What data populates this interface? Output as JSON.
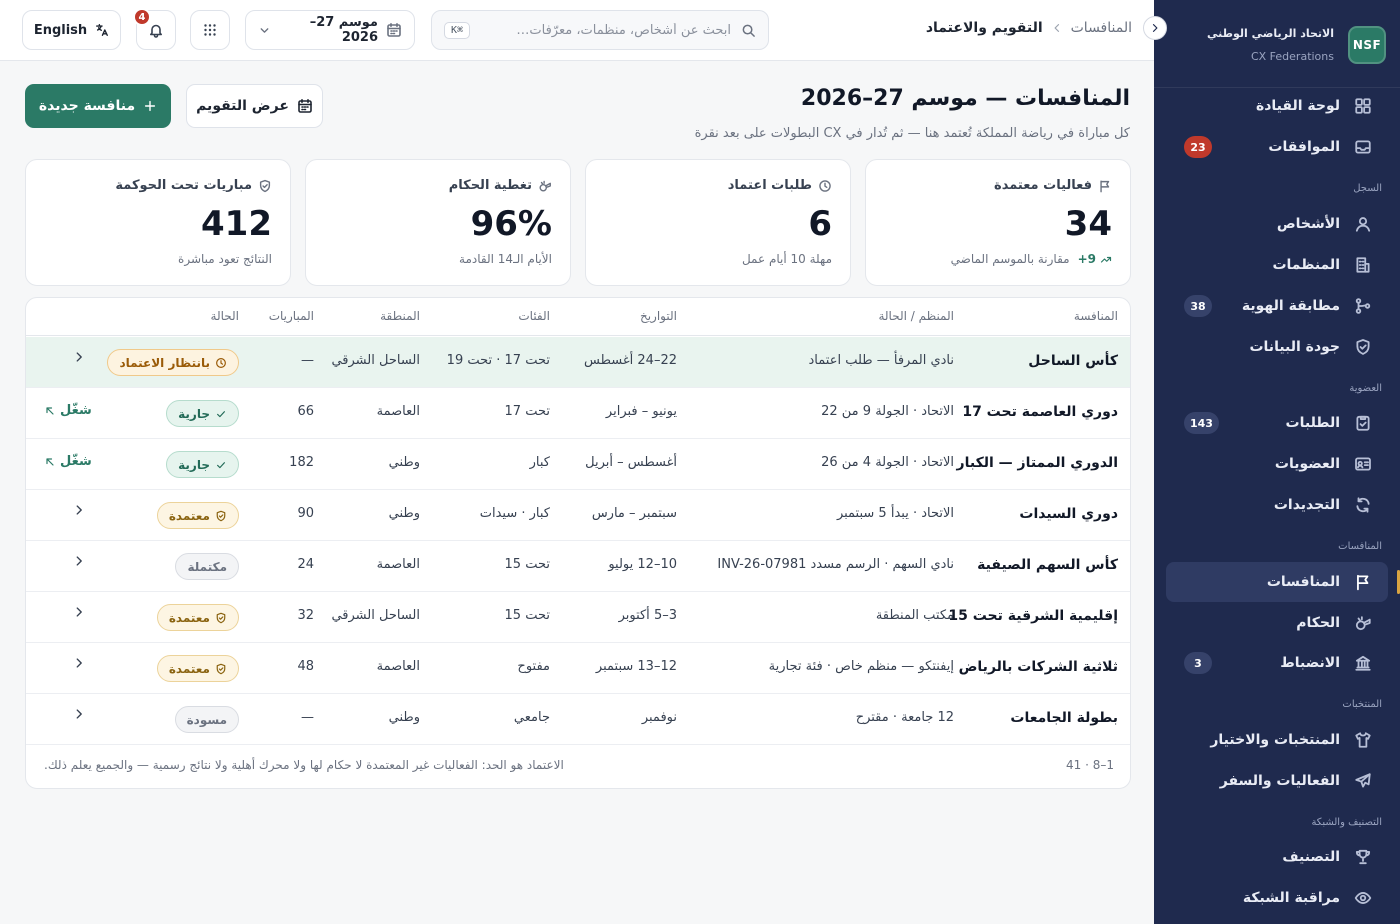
{
  "brand": {
    "logo": "NSF",
    "name": "الاتحاد الرياضي الوطني",
    "sub": "CX Federations"
  },
  "sidebar": {
    "sections": {
      "registry": "السجل",
      "membership": "العضوية",
      "competitions": "المنافسات",
      "teams": "المنتخبات",
      "ranking": "التصنيف والشبكة"
    },
    "items": [
      {
        "label": "لوحة القيادة",
        "icon": "dashboard-icon"
      },
      {
        "label": "الموافقات",
        "icon": "inbox-icon",
        "badge": "23"
      },
      {
        "label": "الأشخاص",
        "icon": "person-icon"
      },
      {
        "label": "المنظمات",
        "icon": "building-icon"
      },
      {
        "label": "مطابقة الهوية",
        "icon": "merge-icon",
        "badge": "38"
      },
      {
        "label": "جودة البيانات",
        "icon": "shield-check-icon"
      },
      {
        "label": "الطلبات",
        "icon": "clipboard-check-icon",
        "badge": "143"
      },
      {
        "label": "العضويات",
        "icon": "id-card-icon"
      },
      {
        "label": "التجديدات",
        "icon": "refresh-icon"
      },
      {
        "label": "المنافسات",
        "icon": "flag-icon"
      },
      {
        "label": "الحكام",
        "icon": "whistle-icon"
      },
      {
        "label": "الانضباط",
        "icon": "gavel-icon",
        "badge": "3"
      },
      {
        "label": "المنتخبات والاختيار",
        "icon": "shirt-icon"
      },
      {
        "label": "الفعاليات والسفر",
        "icon": "plane-icon"
      },
      {
        "label": "التصنيف",
        "icon": "trophy-icon"
      },
      {
        "label": "مراقبة الشبكة",
        "icon": "eye-icon"
      }
    ]
  },
  "topbar": {
    "breadcrumb_parent": "المنافسات",
    "breadcrumb_current": "التقويم والاعتماد",
    "search_placeholder": "ابحث عن أشخاص، منظمات، معرّفات…",
    "search_shortcut": "⌘K",
    "season": "موسم 27–2026",
    "notifications_count": "4",
    "language": "English"
  },
  "page": {
    "title": "المنافسات — موسم 27–2026",
    "subtitle": "كل مباراة في رياضة المملكة تُعتمد هنا — ثم تُدار في CX البطولات على بعد نقرة",
    "new_button": "منافسة جديدة",
    "calendar_button": "عرض التقويم"
  },
  "kpis": [
    {
      "title": "فعاليات معتمدة",
      "icon": "flag-icon",
      "value": "34",
      "delta": "+9",
      "foot": "مقارنة بالموسم الماضي"
    },
    {
      "title": "طلبات اعتماد",
      "icon": "clock-icon",
      "value": "6",
      "foot": "مهلة 10 أيام عمل"
    },
    {
      "title": "تغطية الحكام",
      "icon": "whistle-icon",
      "value": "96%",
      "foot": "الأيام الـ14 القادمة"
    },
    {
      "title": "مباريات تحت الحوكمة",
      "icon": "shield-check-icon",
      "value": "412",
      "foot": "النتائج تعود مباشرة"
    }
  ],
  "table": {
    "columns": [
      "المنافسة",
      "المنظم / الحالة",
      "التواريخ",
      "الفئات",
      "المنطقة",
      "المباريات",
      "الحالة"
    ],
    "rows": [
      {
        "name": "كأس الساحل",
        "org": "نادي المرفأ — طلب اعتماد",
        "dates": "22–24 أغسطس",
        "cats": "تحت 17 · تحت 19",
        "region": "الساحل الشرقي",
        "matches": "—",
        "status": "بانتظار الاعتماد",
        "status_kind": "pending",
        "action": "chevron"
      },
      {
        "name": "دوري العاصمة تحت 17",
        "org": "الاتحاد · الجولة 9 من 22",
        "dates": "يونيو – فبراير",
        "cats": "تحت 17",
        "region": "العاصمة",
        "matches": "66",
        "status": "جارية",
        "status_kind": "ongoing",
        "action": "شغّل"
      },
      {
        "name": "الدوري الممتاز — الكبار",
        "org": "الاتحاد · الجولة 4 من 26",
        "dates": "أغسطس – أبريل",
        "cats": "كبار",
        "region": "وطني",
        "matches": "182",
        "status": "جارية",
        "status_kind": "ongoing",
        "action": "شغّل"
      },
      {
        "name": "دوري السيدات",
        "org": "الاتحاد · يبدأ 5 سبتمبر",
        "dates": "سبتمبر – مارس",
        "cats": "كبار · سيدات",
        "region": "وطني",
        "matches": "90",
        "status": "معتمدة",
        "status_kind": "approved",
        "action": "chevron"
      },
      {
        "name": "كأس السهم الصيفية",
        "org": "نادي السهم · الرسم مسدد INV-26-07981",
        "dates": "10–12 يوليو",
        "cats": "تحت 15",
        "region": "العاصمة",
        "matches": "24",
        "status": "مكتملة",
        "status_kind": "done",
        "action": "chevron"
      },
      {
        "name": "إقليمية الشرقية تحت 15",
        "org": "مكتب المنطقة",
        "dates": "3–5 أكتوبر",
        "cats": "تحت 15",
        "region": "الساحل الشرقي",
        "matches": "32",
        "status": "معتمدة",
        "status_kind": "approved",
        "action": "chevron"
      },
      {
        "name": "ثلاثية الشركات بالرياض",
        "org": "إيفنتكو — منظم خاص · فئة تجارية",
        "dates": "12–13 سبتمبر",
        "cats": "مفتوح",
        "region": "العاصمة",
        "matches": "48",
        "status": "معتمدة",
        "status_kind": "approved",
        "action": "chevron"
      },
      {
        "name": "بطولة الجامعات",
        "org": "12 جامعة · مقترح",
        "dates": "نوفمبر",
        "cats": "جامعي",
        "region": "وطني",
        "matches": "—",
        "status": "مسودة",
        "status_kind": "draft",
        "action": "chevron"
      }
    ],
    "pager": "1–8 · 41",
    "note": "الاعتماد هو الحد: الفعاليات غير المعتمدة لا حكام لها ولا محرك أهلية ولا نتائج رسمية — والجميع يعلم ذلك."
  },
  "colors": {
    "sidebar": "#1f2a4e",
    "accent": "#2b7a66",
    "badge_red": "#c0392b",
    "active_marker": "#d9a441"
  }
}
